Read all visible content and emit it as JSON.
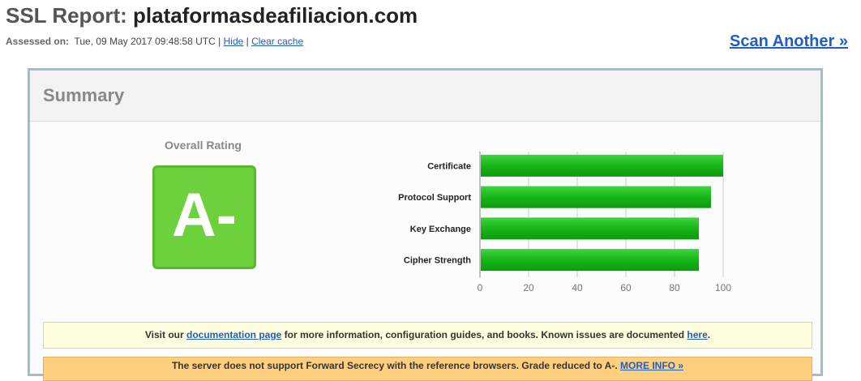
{
  "header": {
    "title_prefix": "SSL Report:",
    "domain": "plataformasdeafiliacion.com",
    "assessed_label": "Assessed on:",
    "assessed_value": "Tue, 09 May 2017 09:48:58 UTC",
    "separator": "|",
    "hide_link": "Hide",
    "clear_cache_link": "Clear cache",
    "scan_another": "Scan Another »"
  },
  "summary": {
    "title": "Summary",
    "rating_label": "Overall Rating",
    "grade": "A-",
    "grade_color": "#6dd13d"
  },
  "chart_data": {
    "type": "bar",
    "orientation": "horizontal",
    "categories": [
      "Certificate",
      "Protocol Support",
      "Key Exchange",
      "Cipher Strength"
    ],
    "values": [
      100,
      95,
      90,
      90
    ],
    "xlim": [
      0,
      100
    ],
    "xticks": [
      0,
      20,
      40,
      60,
      80,
      100
    ],
    "bar_color": "#22bb22",
    "grid": true
  },
  "notices": {
    "docs_prefix": "Visit our ",
    "docs_link": "documentation page",
    "docs_middle": " for more information, configuration guides, and books. Known issues are documented ",
    "docs_here": "here",
    "docs_end": ".",
    "warning_text": "The server does not support Forward Secrecy with the reference browsers. Grade reduced to A-.",
    "warning_link": "MORE INFO »"
  }
}
